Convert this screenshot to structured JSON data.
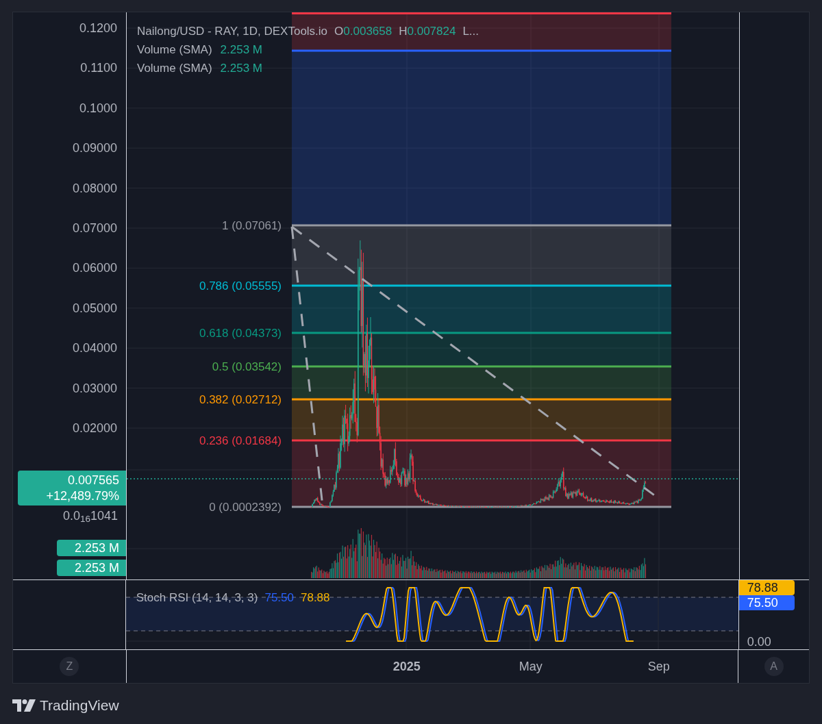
{
  "legend": {
    "symbol": "Nailong/USD - RAY, 1D, DEXTools.io",
    "ohlc": [
      {
        "key": "O",
        "value": "0.003658"
      },
      {
        "key": "H",
        "value": "0.007824"
      }
    ],
    "more": "L...",
    "indicators": [
      {
        "name": "Volume (SMA)",
        "value": "2.253 M"
      },
      {
        "name": "Volume (SMA)",
        "value": "2.253 M"
      }
    ]
  },
  "price_axis": {
    "ticks": [
      "0.1200",
      "0.1100",
      "0.1000",
      "0.09000",
      "0.08000",
      "0.07000",
      "0.06000",
      "0.05000",
      "0.04000",
      "0.03000",
      "0.02000"
    ],
    "last_tick": "0.0$_{16}$1041"
  },
  "price_badge": {
    "price": "0.007565",
    "change": "+12,489.79%"
  },
  "volume_badges": [
    "2.253 M",
    "2.253 M"
  ],
  "fib_levels": [
    {
      "color": "#f23645"
    },
    {
      "color": "#2962ff"
    },
    {
      "label": "1 (0.07061)",
      "color": "#9598a1"
    },
    {
      "label": "0.786 (0.05555)",
      "color": "#00bcd4"
    },
    {
      "label": "0.618 (0.04373)",
      "color": "#089981"
    },
    {
      "label": "0.5 (0.03542)",
      "color": "#4caf50"
    },
    {
      "label": "0.382 (0.02712)",
      "color": "#ff9800"
    },
    {
      "label": "0.236 (0.01684)",
      "color": "#f23645"
    },
    {
      "label": "0 (0.0002392)",
      "color": "#9598a1"
    }
  ],
  "stoch_rsi": {
    "name": "Stoch RSI (14, 14, 3, 3)",
    "lines": [
      {
        "value": "75.50",
        "color": "#2962ff"
      },
      {
        "value": "78.88",
        "color": "#f7b500"
      }
    ],
    "axis_badges": [
      {
        "value": "78.88",
        "color": "#f7b500"
      },
      {
        "value": "75.50",
        "color": "#2962ff"
      }
    ],
    "axis_tick": "0.00"
  },
  "time_axis": [
    {
      "label": "2025",
      "bold": true
    },
    {
      "label": "May",
      "bold": false
    },
    {
      "label": "Sep",
      "bold": false
    }
  ],
  "corner_buttons": [
    "Z",
    "A"
  ],
  "brand": "TradingView"
}
